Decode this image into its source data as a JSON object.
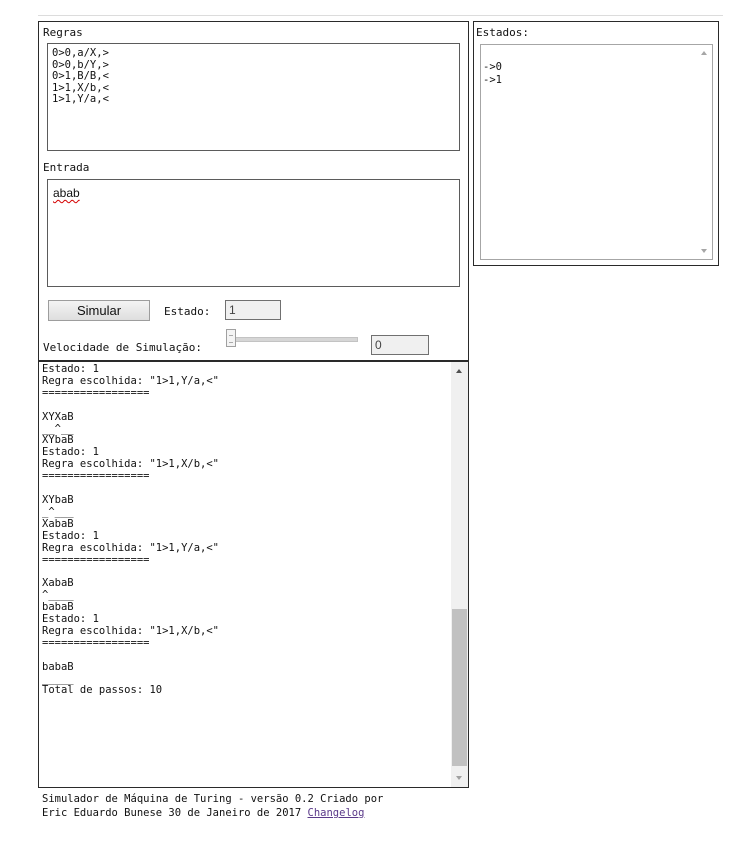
{
  "rules": {
    "label": "Regras",
    "lines": "0>0,a/X,>\n0>0,b/Y,>\n0>1,B/B,<\n1>1,X/b,<\n1>1,Y/a,<"
  },
  "input": {
    "label": "Entrada",
    "value": "abab"
  },
  "controls": {
    "simulate_label": "Simular",
    "state_label": "Estado:",
    "state_value": "1",
    "speed_label": "Velocidade de Simulação:",
    "speed_value": "0"
  },
  "states": {
    "title": "Estados:",
    "items": "->0\n->1"
  },
  "log": {
    "text": "Estado: 1\nRegra escolhida: \"1>1,Y/a,<\"\n=================\n\nXYXaB\n__^__\nXYbaB\nEstado: 1\nRegra escolhida: \"1>1,X/b,<\"\n=================\n\nXYbaB\n_^___\nXabaB\nEstado: 1\nRegra escolhida: \"1>1,Y/a,<\"\n=================\n\nXabaB\n^____\nbabaB\nEstado: 1\nRegra escolhida: \"1>1,X/b,<\"\n=================\n\nbabaB\n_____\nTotal de passos: 10"
  },
  "footer": {
    "text": "Simulador de Máquina de Turing - versão 0.2 Criado por\nEric Eduardo Bunese 30 de Janeiro de 2017 ",
    "link_label": "Changelog"
  }
}
